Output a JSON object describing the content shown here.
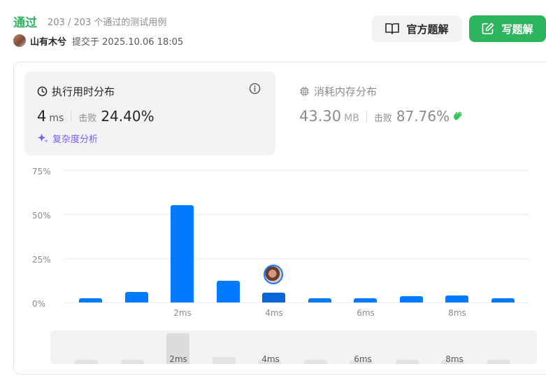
{
  "header": {
    "status": "通过",
    "test_cases": "203 / 203 个通过的测试用例",
    "username": "山有木兮",
    "submitted_at": "提交于 2025.10.06 18:05",
    "official_solution_label": "官方题解",
    "write_solution_label": "写题解"
  },
  "runtime": {
    "title": "执行用时分布",
    "value": "4",
    "unit": "ms",
    "beats_label": "击败",
    "beats": "24.40%",
    "complexity_label": "复杂度分析"
  },
  "memory": {
    "title": "消耗内存分布",
    "value": "43.30",
    "unit": "MB",
    "beats_label": "击败",
    "beats": "87.76%"
  },
  "chart_data": {
    "type": "bar",
    "title": "",
    "ylabel": "",
    "xlabel": "",
    "ylim": [
      0,
      75
    ],
    "y_ticks": [
      "75%",
      "50%",
      "25%",
      "0%"
    ],
    "x_tick_labels": [
      "2ms",
      "4ms",
      "6ms",
      "8ms"
    ],
    "series": [
      {
        "values": [
          2.5,
          6,
          55,
          12.5,
          5.5,
          2.5,
          2.5,
          3.5,
          4,
          2.5
        ]
      }
    ],
    "active_index": 4
  },
  "minimap": {
    "labels": [
      "2ms",
      "4ms",
      "6ms",
      "8ms"
    ]
  },
  "colors": {
    "accent_green": "#2db55d",
    "bar_blue": "#007aff",
    "purple": "#7c5cf5"
  }
}
